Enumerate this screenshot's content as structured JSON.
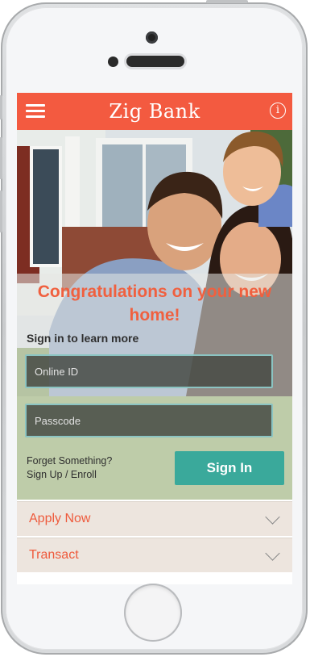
{
  "app": {
    "title": "Zig Bank"
  },
  "hero": {
    "headline": "Congratulations on your new home!",
    "subhead": "Sign in to learn more"
  },
  "form": {
    "online_id_placeholder": "Online ID",
    "passcode_placeholder": "Passcode",
    "forgot_label": "Forget Something?",
    "signup_label": "Sign Up / Enroll",
    "signin_label": "Sign In"
  },
  "accordion": {
    "apply_now": "Apply Now",
    "transact": "Transact"
  },
  "colors": {
    "brand": "#f35a40",
    "accent": "#3aa99b",
    "panel": "#ede5de"
  },
  "icons": {
    "menu": "hamburger-icon",
    "info": "info-icon",
    "chevron": "chevron-down-icon"
  }
}
